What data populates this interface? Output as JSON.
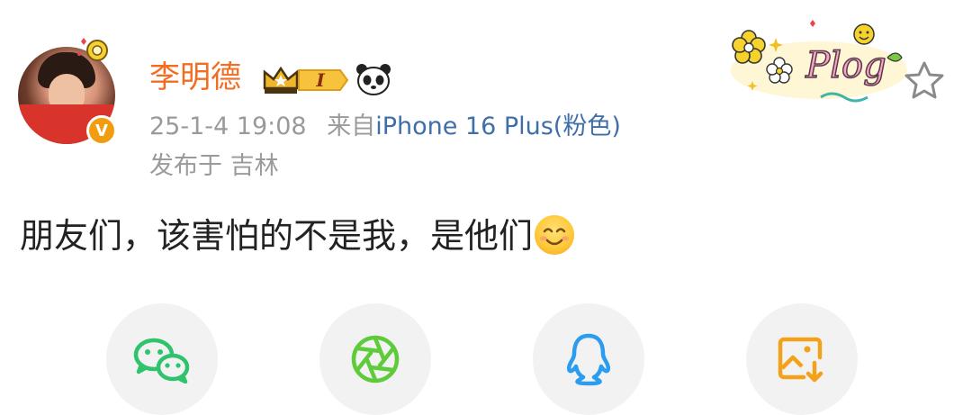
{
  "post": {
    "author": "李明德",
    "timestamp": "25-1-4 19:08",
    "source_prefix": "来自",
    "source_device": "iPhone 16 Plus(粉色)",
    "location": "发布于 吉林",
    "content": "朋友们，该害怕的不是我，是他们",
    "verified_badge": "V",
    "level_badge": "I",
    "sticker_text": "Plog"
  },
  "share_bar": [
    {
      "icon": "wechat-icon",
      "color": "#2fc36c"
    },
    {
      "icon": "moments-icon",
      "color": "#5ecb3b"
    },
    {
      "icon": "qq-icon",
      "color": "#2c9cf0"
    },
    {
      "icon": "save-image-icon",
      "color": "#f4a11a"
    }
  ],
  "colors": {
    "username": "#f26d21",
    "source_link": "#3f6fa8",
    "meta_text": "#9a9a9a",
    "verified_badge": "#f29c11"
  }
}
